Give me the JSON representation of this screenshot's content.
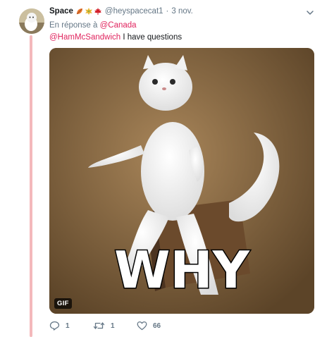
{
  "tweet": {
    "display_name": "Space",
    "name_emoji": [
      "leaf-orange-icon",
      "leaf-yellow-icon",
      "maple-leaf-icon"
    ],
    "handle": "@heyspacecat1",
    "separator": "·",
    "timestamp": "3 nov.",
    "replying_prefix": "En réponse à",
    "replying_to": "@Canada",
    "mention": "@HamMcSandwich",
    "body": " I have questions",
    "media": {
      "badge": "GIF",
      "caption_text": "WHY"
    },
    "actions": {
      "reply_count": "1",
      "retweet_count": "1",
      "like_count": "66"
    }
  },
  "colors": {
    "accent": "#e0245e",
    "thread_line": "#f4b9bb",
    "secondary_text": "#657786"
  }
}
